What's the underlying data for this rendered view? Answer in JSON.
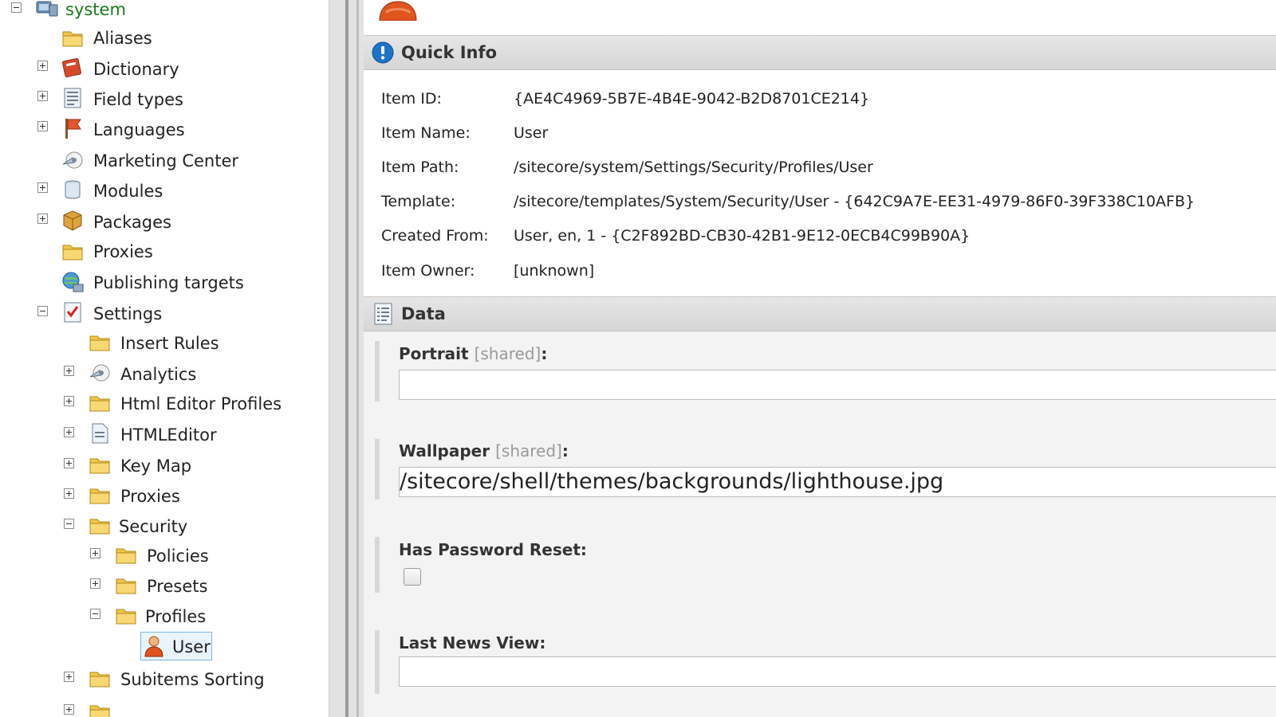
{
  "tree": {
    "root": "system",
    "items": [
      {
        "label": "Aliases"
      },
      {
        "label": "Dictionary"
      },
      {
        "label": "Field types"
      },
      {
        "label": "Languages"
      },
      {
        "label": "Marketing Center"
      },
      {
        "label": "Modules"
      },
      {
        "label": "Packages"
      },
      {
        "label": "Proxies"
      },
      {
        "label": "Publishing targets"
      },
      {
        "label": "Settings"
      },
      {
        "label": "Insert Rules"
      },
      {
        "label": "Analytics"
      },
      {
        "label": "Html Editor Profiles"
      },
      {
        "label": "HTMLEditor"
      },
      {
        "label": "Key Map"
      },
      {
        "label": "Proxies"
      },
      {
        "label": "Security"
      },
      {
        "label": "Policies"
      },
      {
        "label": "Presets"
      },
      {
        "label": "Profiles"
      },
      {
        "label": "User"
      },
      {
        "label": "Subitems Sorting"
      }
    ]
  },
  "quick_info": {
    "title": "Quick Info",
    "rows": [
      {
        "key": "Item ID:",
        "value": "{AE4C4969-5B7E-4B4E-9042-B2D8701CE214}"
      },
      {
        "key": "Item Name:",
        "value": "User"
      },
      {
        "key": "Item Path:",
        "value": "/sitecore/system/Settings/Security/Profiles/User"
      },
      {
        "key": "Template:",
        "value": "/sitecore/templates/System/Security/User - {642C9A7E-EE31-4979-86F0-39F338C10AFB}"
      },
      {
        "key": "Created From:",
        "value": "User, en, 1 - {C2F892BD-CB30-42B1-9E12-0ECB4C99B90A}"
      },
      {
        "key": "Item Owner:",
        "value": "[unknown]"
      }
    ]
  },
  "data_section": {
    "title": "Data",
    "shared_tag": "[shared]",
    "fields": {
      "portrait": {
        "label": "Portrait",
        "value": ""
      },
      "wallpaper": {
        "label": "Wallpaper",
        "value": "/sitecore/shell/themes/backgrounds/lighthouse.jpg"
      },
      "has_password_reset": {
        "label": "Has Password Reset:"
      },
      "last_news_view": {
        "label": "Last News View:",
        "value": ""
      }
    }
  },
  "colors": {
    "root_label": "#1a7a1a",
    "section_header": "#dcdcdc",
    "info_icon": "#1e73c8",
    "selected_bg": "#eaf4fc",
    "selected_border": "#7ab6e6"
  }
}
